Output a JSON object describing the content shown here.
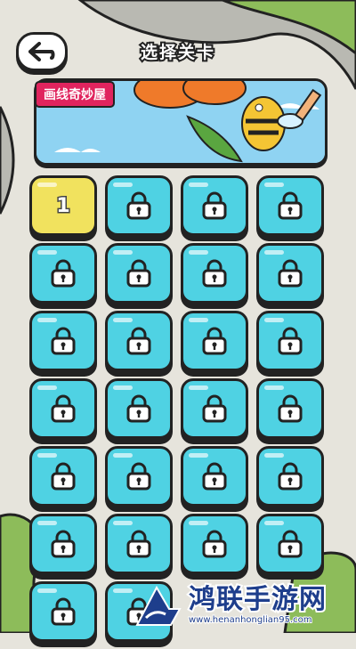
{
  "header": {
    "title": "选择关卡",
    "back_icon": "arrow-back-icon"
  },
  "banner": {
    "tag": "画线奇妙屋"
  },
  "levels": [
    {
      "label": "1",
      "locked": false
    },
    {
      "label": "",
      "locked": true
    },
    {
      "label": "",
      "locked": true
    },
    {
      "label": "",
      "locked": true
    },
    {
      "label": "",
      "locked": true
    },
    {
      "label": "",
      "locked": true
    },
    {
      "label": "",
      "locked": true
    },
    {
      "label": "",
      "locked": true
    },
    {
      "label": "",
      "locked": true
    },
    {
      "label": "",
      "locked": true
    },
    {
      "label": "",
      "locked": true
    },
    {
      "label": "",
      "locked": true
    },
    {
      "label": "",
      "locked": true
    },
    {
      "label": "",
      "locked": true
    },
    {
      "label": "",
      "locked": true
    },
    {
      "label": "",
      "locked": true
    },
    {
      "label": "",
      "locked": true
    },
    {
      "label": "",
      "locked": true
    },
    {
      "label": "",
      "locked": true
    },
    {
      "label": "",
      "locked": true
    },
    {
      "label": "",
      "locked": true
    },
    {
      "label": "",
      "locked": true
    },
    {
      "label": "",
      "locked": true
    },
    {
      "label": "",
      "locked": true
    },
    {
      "label": "",
      "locked": true
    },
    {
      "label": "",
      "locked": true
    }
  ],
  "watermark": {
    "title": "鸿联手游网",
    "url": "www.henanhonglian95.com"
  },
  "colors": {
    "tile_locked": "#4fd2e3",
    "tile_unlocked": "#f1e25e",
    "tag": "#e0245e"
  }
}
